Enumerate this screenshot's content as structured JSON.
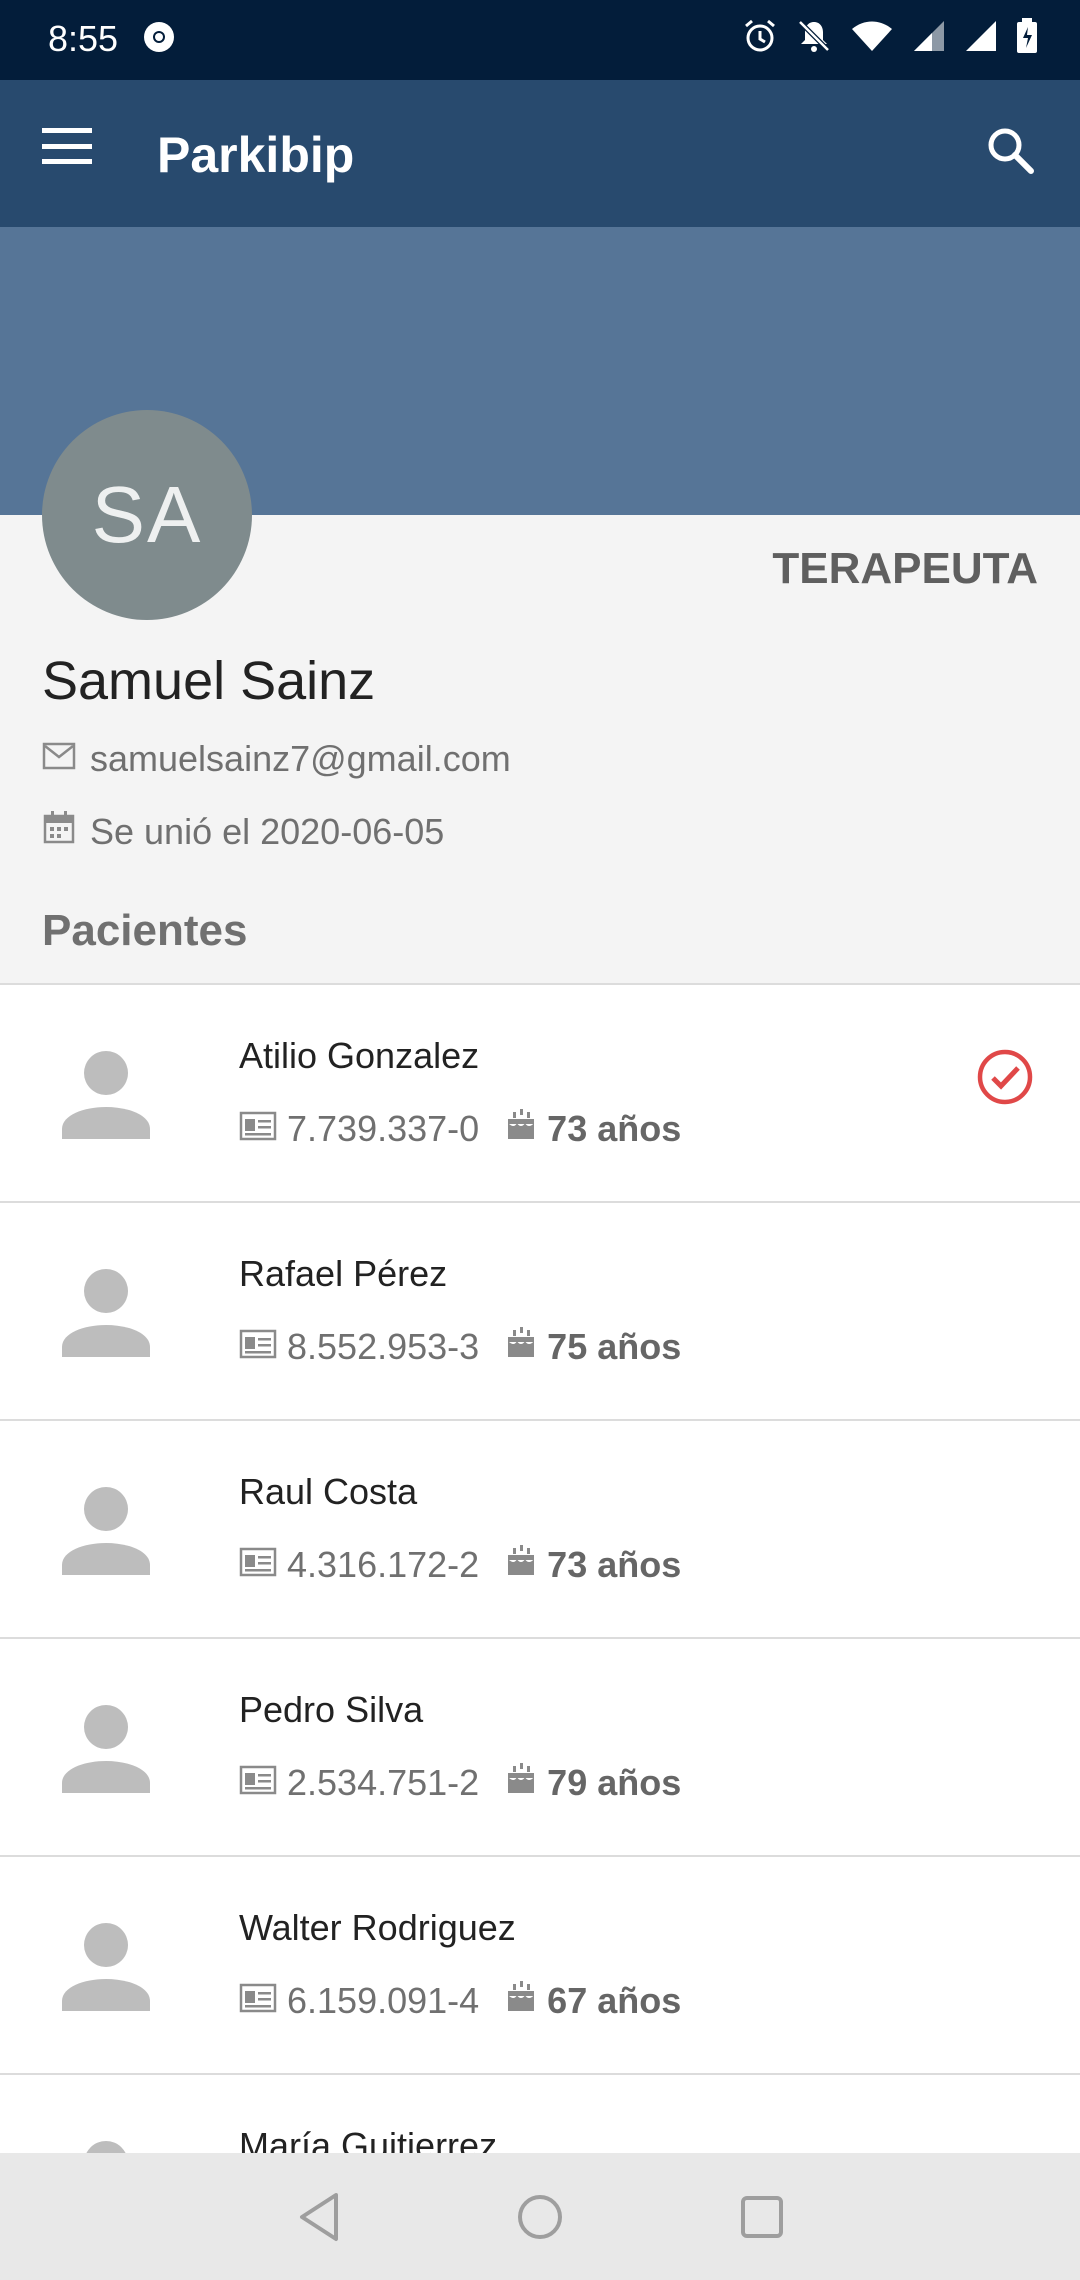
{
  "status_bar": {
    "time": "8:55"
  },
  "app_bar": {
    "title": "Parkibip"
  },
  "profile": {
    "initials": "SA",
    "role": "TERAPEUTA",
    "name": "Samuel Sainz",
    "email": "samuelsainz7@gmail.com",
    "joined": "Se unió el 2020-06-05"
  },
  "patients_section": {
    "title": "Pacientes",
    "items": [
      {
        "name": "Atilio  Gonzalez",
        "id": "7.739.337-0",
        "age": "73 años",
        "selected": true
      },
      {
        "name": "Rafael Pérez",
        "id": "8.552.953-3",
        "age": "75 años",
        "selected": false
      },
      {
        "name": "Raul Costa",
        "id": "4.316.172-2",
        "age": "73 años",
        "selected": false
      },
      {
        "name": "Pedro Silva",
        "id": "2.534.751-2",
        "age": "79 años",
        "selected": false
      },
      {
        "name": "Walter Rodriguez",
        "id": "6.159.091-4",
        "age": "67 años",
        "selected": false
      },
      {
        "name": "María Guitierrez",
        "id": "",
        "age": "",
        "selected": false
      }
    ]
  },
  "colors": {
    "status_bar": "#031d3a",
    "app_bar": "#284a6e",
    "header_band": "#567597",
    "avatar": "#7f8b8d",
    "check": "#e04848"
  },
  "icons": {
    "menu": "menu-icon",
    "search": "search-icon",
    "email": "mail-icon",
    "joined": "calendar-icon",
    "patient_avatar": "person-icon",
    "patient_id": "id-card-icon",
    "patient_age": "cake-icon",
    "selected": "check-circle-icon"
  }
}
